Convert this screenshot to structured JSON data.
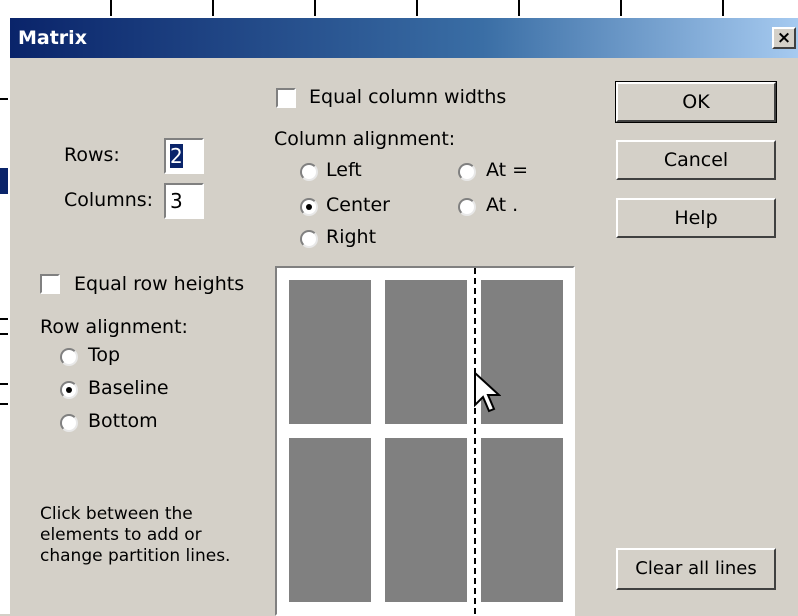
{
  "dialog": {
    "title": "Matrix",
    "close_glyph": "×"
  },
  "rows_label": "Rows:",
  "rows_value": "2",
  "columns_label": "Columns:",
  "columns_value": "3",
  "equal_column_widths": {
    "label": "Equal column widths",
    "checked": false
  },
  "column_alignment": {
    "heading": "Column alignment:",
    "options": [
      {
        "label": "Left",
        "selected": false
      },
      {
        "label": "At =",
        "selected": false
      },
      {
        "label": "Center",
        "selected": true
      },
      {
        "label": "At .",
        "selected": false
      },
      {
        "label": "Right",
        "selected": false
      }
    ]
  },
  "equal_row_heights": {
    "label": "Equal row heights",
    "checked": false
  },
  "row_alignment": {
    "heading": "Row alignment:",
    "options": [
      {
        "label": "Top",
        "selected": false
      },
      {
        "label": "Baseline",
        "selected": true
      },
      {
        "label": "Bottom",
        "selected": false
      }
    ]
  },
  "hint": [
    "Click between the",
    "elements to add or",
    "change partition lines."
  ],
  "buttons": {
    "ok": "OK",
    "cancel": "Cancel",
    "help": "Help",
    "clear_all_lines": "Clear all lines"
  },
  "icons": {
    "close": "close-icon",
    "cursor": "arrow-cursor-icon"
  },
  "colors": {
    "dialog_bg": "#d4d0c8",
    "title_gradient_start": "#0a246a",
    "title_gradient_end": "#a6caf0",
    "cell_gray": "#808080"
  }
}
